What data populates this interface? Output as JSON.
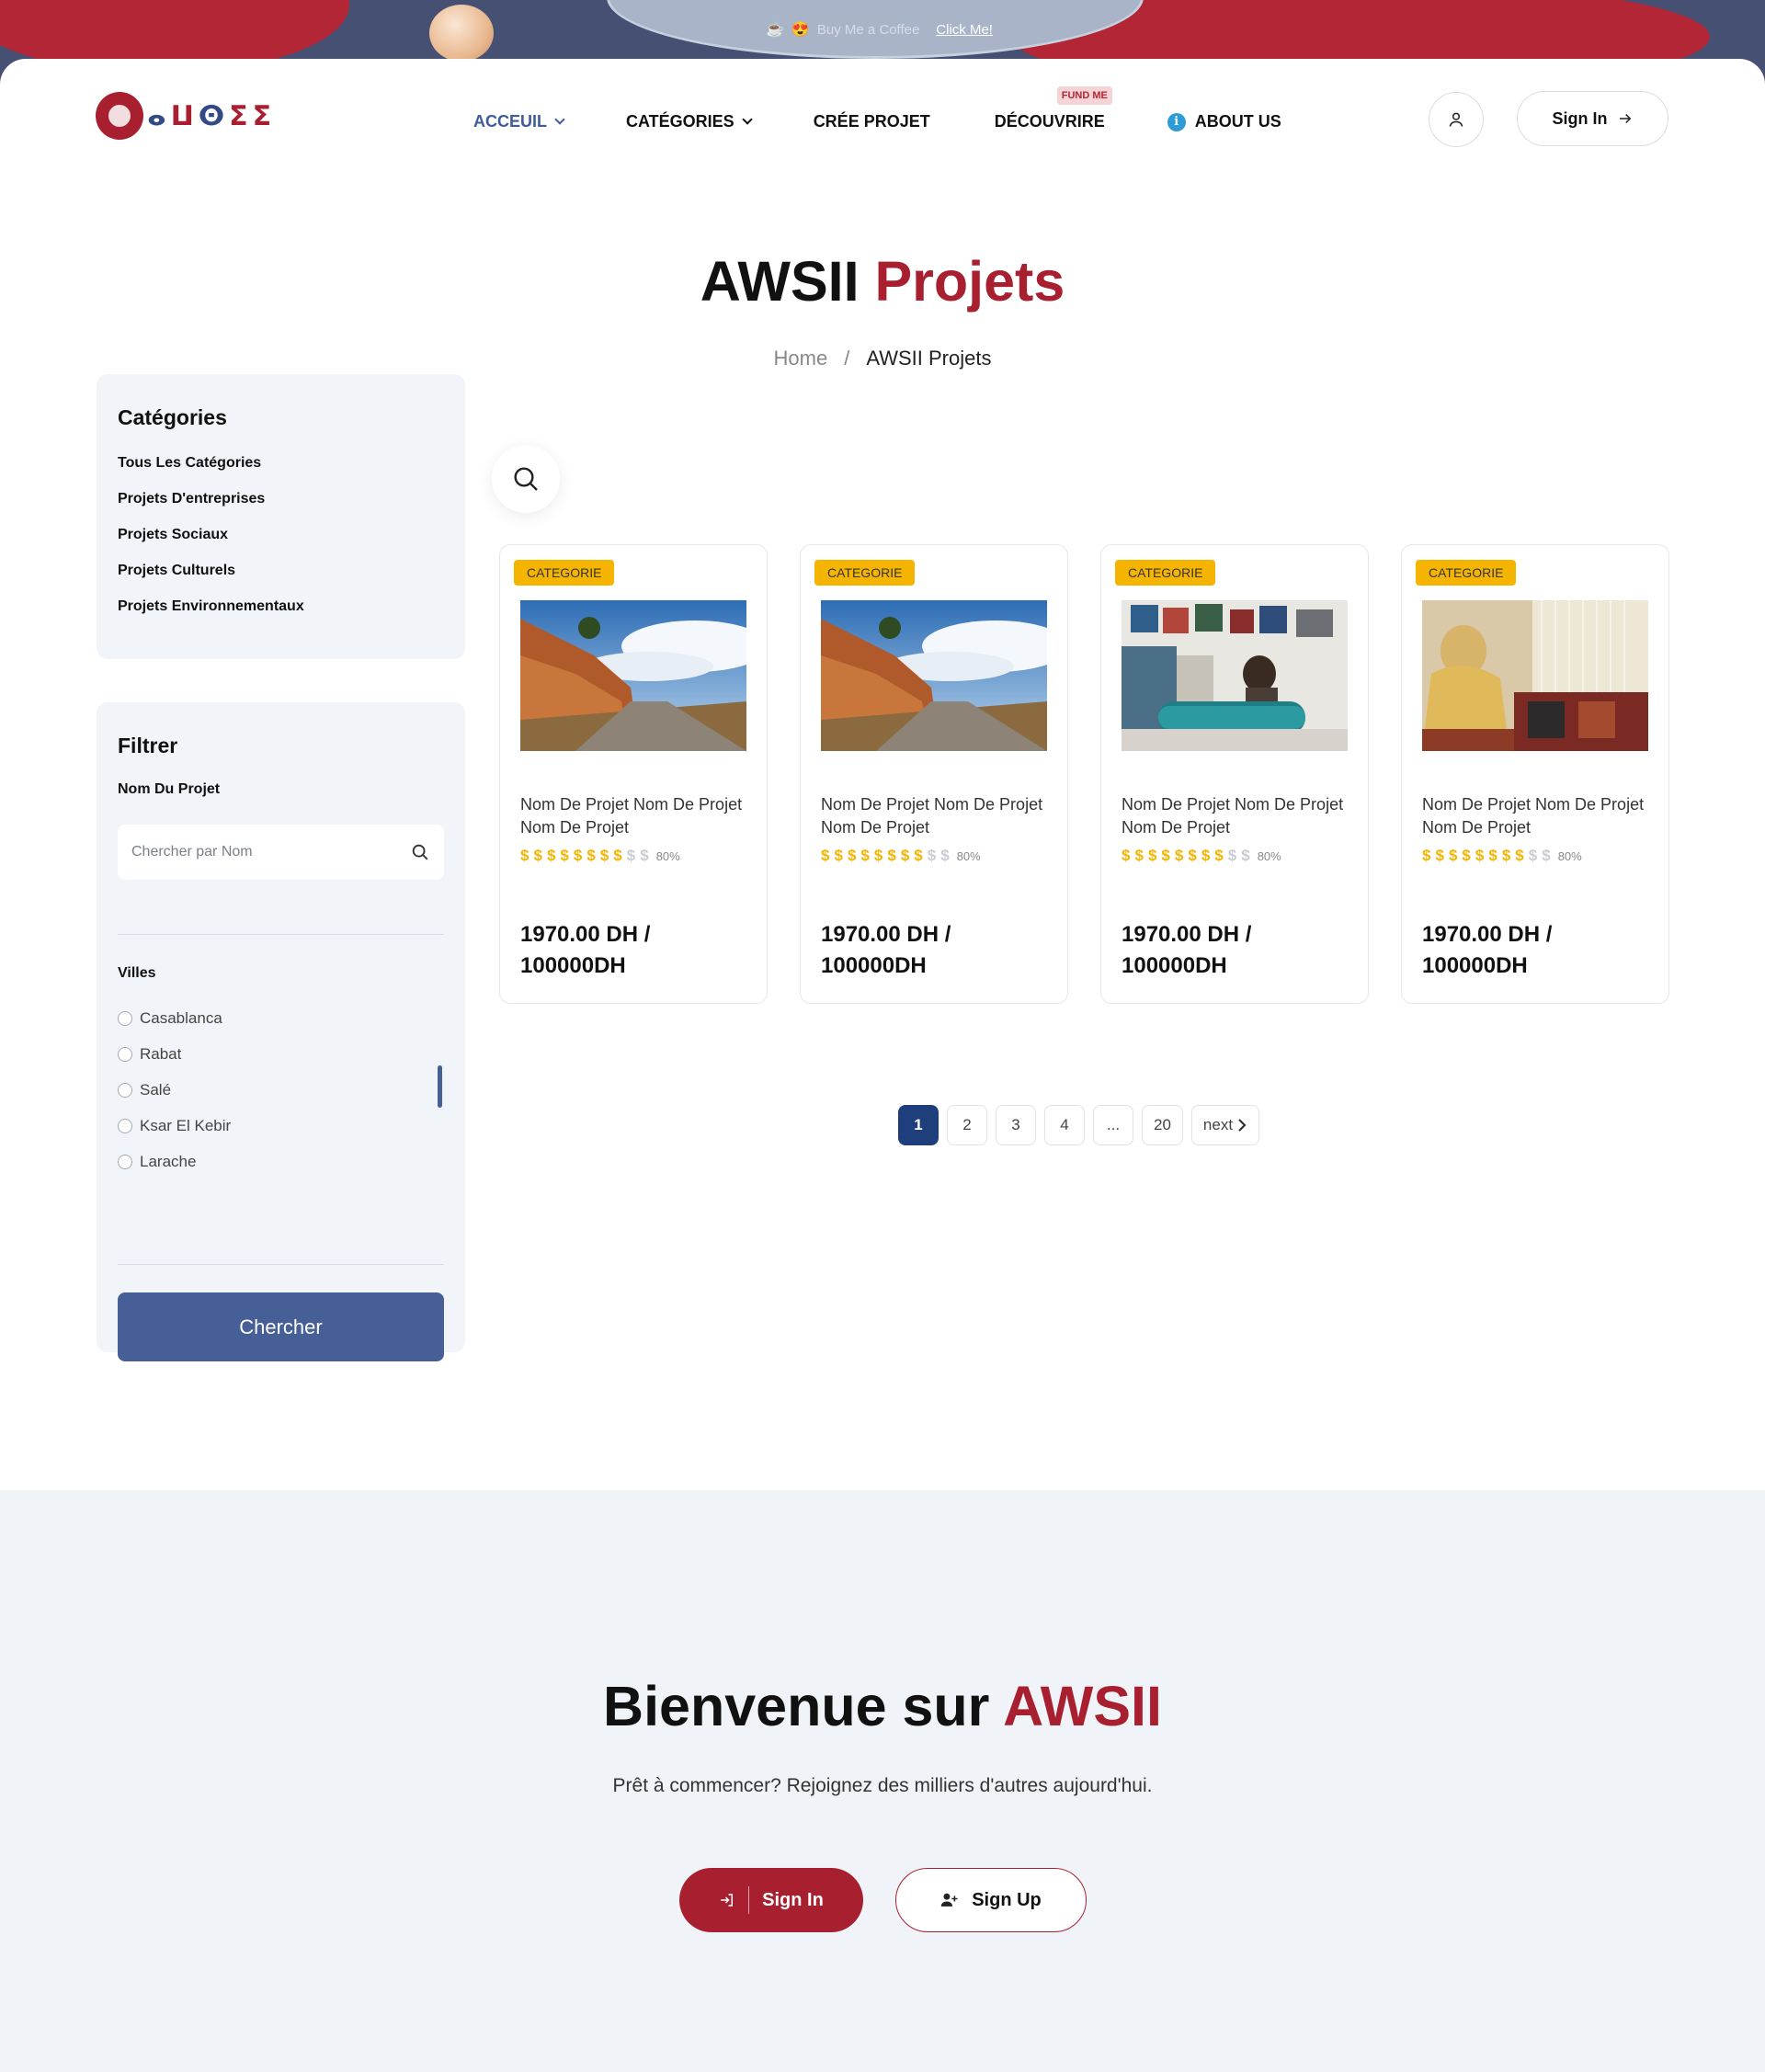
{
  "promo": {
    "text": "Buy Me a Coffee",
    "link": "Click Me!",
    "emoji1": "☕",
    "emoji2": "😍"
  },
  "header": {
    "logo_text": "AWSII",
    "logo_glyphs": [
      "ⴰ",
      "ⵡ",
      "ⵙ",
      "ⵉ",
      "ⵉ"
    ],
    "nav": [
      {
        "label": "ACCEUIL",
        "dropdown": true,
        "active": true
      },
      {
        "label": "CATÉGORIES",
        "dropdown": true,
        "active": false
      },
      {
        "label": "CRÉE PROJET",
        "dropdown": false,
        "active": false
      },
      {
        "label": "DÉCOUVRIRE",
        "dropdown": false,
        "active": false,
        "badge": "FUND ME"
      },
      {
        "label": "ABOUT US",
        "dropdown": false,
        "active": false,
        "icon": "info-icon"
      }
    ],
    "user_icon": "user-icon",
    "signin_label": "Sign In"
  },
  "title": {
    "main": "AWSII",
    "accent": "Projets"
  },
  "breadcrumb": {
    "home": "Home",
    "separator": "/",
    "current": "AWSII Projets"
  },
  "categories": {
    "heading": "Catégories",
    "items": [
      "Tous Les Catégories",
      "Projets D'entreprises",
      "Projets Sociaux",
      "Projets Culturels",
      "Projets Environnementaux"
    ]
  },
  "filter": {
    "heading": "Filtrer",
    "name_label": "Nom Du Projet",
    "name_placeholder": "Chercher par Nom",
    "cities_label": "Villes",
    "cities": [
      "Casablanca",
      "Rabat",
      "Salé",
      "Ksar El Kebir",
      "Larache"
    ],
    "button": "Chercher"
  },
  "projects": [
    {
      "tag": "CATEGORIE",
      "name": "Nom De Projet Nom De Projet Nom De Projet",
      "rating": 8,
      "rating_max": 10,
      "percent": "80%",
      "price_line1": "1970.00 DH /",
      "price_line2": "100000DH",
      "image": "desert-road"
    },
    {
      "tag": "CATEGORIE",
      "name": "Nom De Projet Nom De Projet Nom De Projet",
      "rating": 8,
      "rating_max": 10,
      "percent": "80%",
      "price_line1": "1970.00 DH /",
      "price_line2": "100000DH",
      "image": "desert-road"
    },
    {
      "tag": "CATEGORIE",
      "name": "Nom De Projet Nom De Projet Nom De Projet",
      "rating": 8,
      "rating_max": 10,
      "percent": "80%",
      "price_line1": "1970.00 DH /",
      "price_line2": "100000DH",
      "image": "tile-workshop"
    },
    {
      "tag": "CATEGORIE",
      "name": "Nom De Projet Nom De Projet Nom De Projet",
      "rating": 8,
      "rating_max": 10,
      "percent": "80%",
      "price_line1": "1970.00 DH /",
      "price_line2": "100000DH",
      "image": "carpet-weaver"
    }
  ],
  "rating_symbol": "$",
  "pagination": {
    "pages": [
      "1",
      "2",
      "3",
      "4",
      "...",
      "20"
    ],
    "current": "1",
    "next": "next"
  },
  "welcome": {
    "title": "Bienvenue sur",
    "accent": "AWSII",
    "subtitle": "Prêt à commencer? Rejoignez des milliers d'autres aujourd'hui.",
    "signin": "Sign In",
    "signup": "Sign Up"
  },
  "colors": {
    "brand_red": "#a81f30",
    "brand_blue": "#465f97",
    "tag_yellow": "#f5b400",
    "nav_bg": "#465072"
  }
}
